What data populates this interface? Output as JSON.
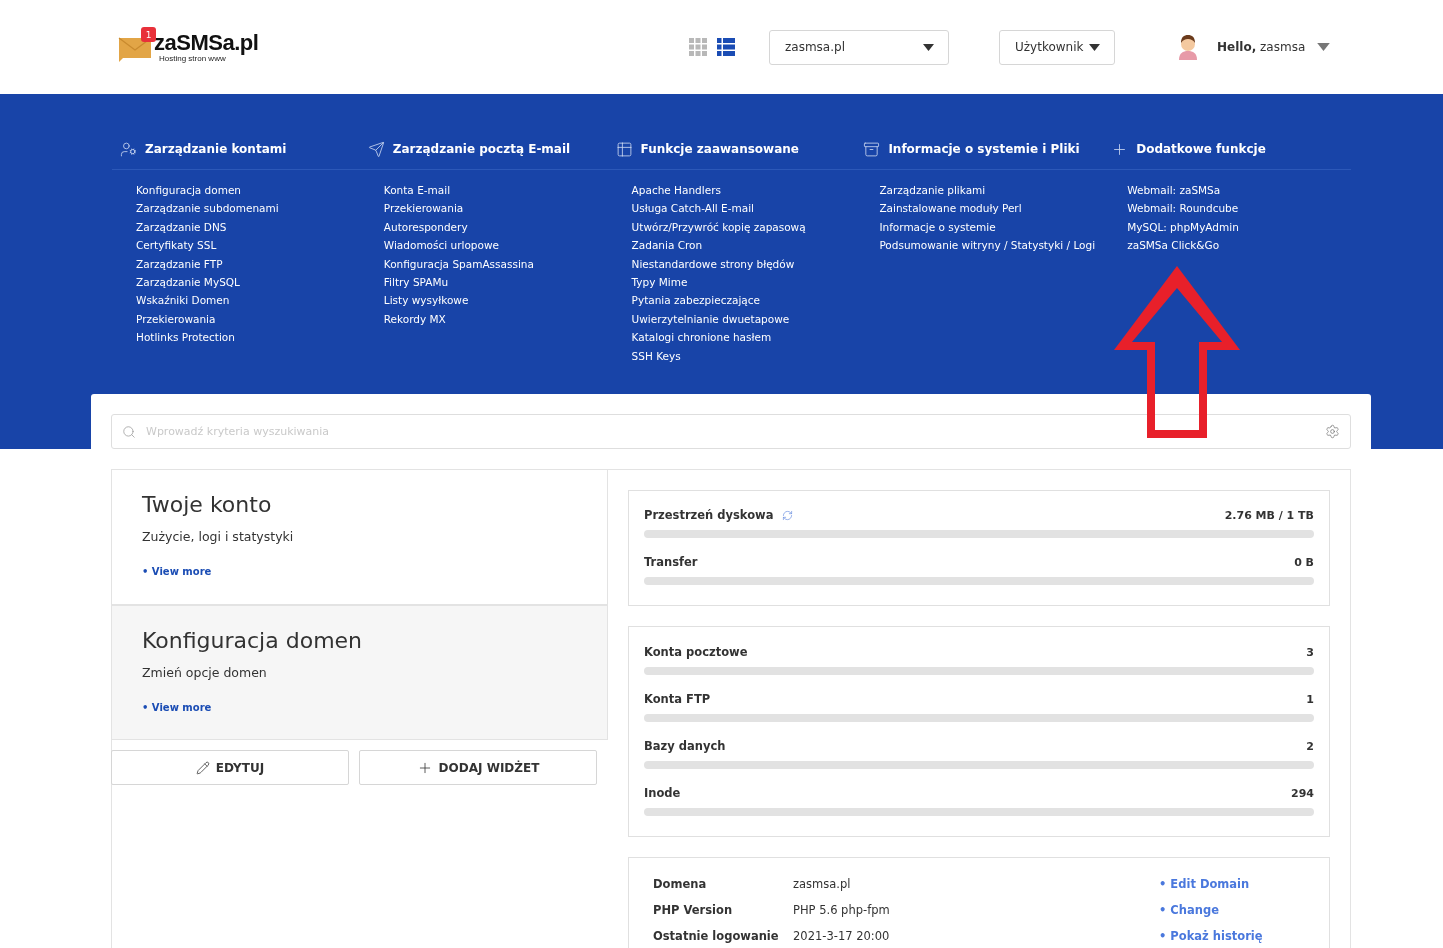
{
  "logo": {
    "badge": "1",
    "name": "zaSMSa.pl",
    "tagline": "Hosting stron www"
  },
  "view_toggle": [
    {
      "kind": "grid",
      "selected": false
    },
    {
      "kind": "list",
      "selected": true
    }
  ],
  "domain_select": {
    "value": "zasmsa.pl"
  },
  "role_select": {
    "value": "Użytkownik"
  },
  "user": {
    "greeting": "Hello,",
    "name": "zasmsa"
  },
  "menu": [
    {
      "kind": "accounts",
      "title": "Zarządzanie kontami",
      "links": [
        "Konfiguracja domen",
        "Zarządzanie subdomenami",
        "Zarządzanie DNS",
        "Certyfikaty SSL",
        "Zarządzanie FTP",
        "Zarządzanie MySQL",
        "Wskaźniki Domen",
        "Przekierowania",
        "Hotlinks Protection"
      ]
    },
    {
      "kind": "mail",
      "title": "Zarządzanie pocztą E-mail",
      "links": [
        "Konta E-mail",
        "Przekierowania",
        "Autorespondery",
        "Wiadomości urlopowe",
        "Konfiguracja SpamAssassina",
        "Filtry SPAMu",
        "Listy wysyłkowe",
        "Rekordy MX"
      ]
    },
    {
      "kind": "advanced",
      "title": "Funkcje zaawansowane",
      "links": [
        "Apache Handlers",
        "Usługa Catch-All E-mail",
        "Utwórz/Przywróć kopię zapasową",
        "Zadania Cron",
        "Niestandardowe strony błędów",
        "Typy Mime",
        "Pytania zabezpieczające",
        "Uwierzytelnianie dwuetapowe",
        "Katalogi chronione hasłem",
        "SSH Keys"
      ]
    },
    {
      "kind": "system",
      "title": "Informacje o systemie i Pliki",
      "links": [
        "Zarządzanie plikami",
        "Zainstalowane moduły Perl",
        "Informacje o systemie",
        "Podsumowanie witryny / Statystyki / Logi"
      ]
    },
    {
      "kind": "extra",
      "title": "Dodatkowe funkcje",
      "links": [
        "Webmail: zaSMSa",
        "Webmail: Roundcube",
        "MySQL: phpMyAdmin",
        "zaSMSa Click&Go"
      ]
    }
  ],
  "annotation": {
    "kind": "up-arrow"
  },
  "search": {
    "placeholder": "Wprowadź kryteria wyszukiwania"
  },
  "widgets": [
    {
      "title": "Twoje konto",
      "subtitle": "Zużycie, logi i statystyki",
      "link": "• View more",
      "selected": false
    },
    {
      "title": "Konfiguracja domen",
      "subtitle": "Zmień opcje domen",
      "link": "• View more",
      "selected": true
    }
  ],
  "actions": [
    {
      "kind": "edit",
      "label": "EDYTUJ"
    },
    {
      "kind": "add",
      "label": "DODAJ WIDŻET"
    }
  ],
  "usage": [
    {
      "label": "Przestrzeń dyskowa",
      "refresh": true,
      "reading": "2.76 MB / 1 TB",
      "level": 0
    },
    {
      "label": "Transfer",
      "refresh": false,
      "reading": "0 B",
      "level": 0
    }
  ],
  "counts": [
    {
      "label": "Konta pocztowe",
      "reading": "3",
      "level": 0
    },
    {
      "label": "Konta FTP",
      "reading": "1",
      "level": 0
    },
    {
      "label": "Bazy danych",
      "reading": "2",
      "level": 0
    },
    {
      "label": "Inode",
      "reading": "294",
      "level": 0
    }
  ],
  "info": [
    {
      "label": "Domena",
      "value": "zasmsa.pl",
      "action": "• Edit Domain"
    },
    {
      "label": "PHP Version",
      "value": "PHP 5.6 php-fpm",
      "action": "• Change"
    },
    {
      "label": "Ostatnie logowanie",
      "value": "2021-3-17 20:00",
      "action": "• Pokaż historię"
    }
  ]
}
